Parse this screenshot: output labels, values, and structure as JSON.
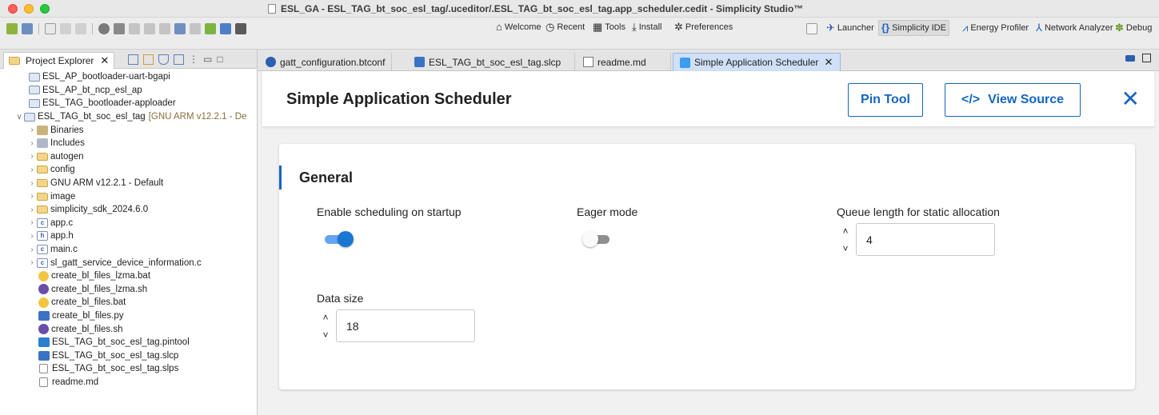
{
  "window": {
    "title": "ESL_GA - ESL_TAG_bt_soc_esl_tag/.uceditor/.ESL_TAG_bt_soc_esl_tag.app_scheduler.cedit - Simplicity Studio™"
  },
  "toolbar": {
    "welcome": "Welcome",
    "recent": "Recent",
    "tools": "Tools",
    "install": "Install",
    "preferences": "Preferences",
    "perspectives": {
      "launcher": "Launcher",
      "ide": "Simplicity IDE",
      "energy": "Energy Profiler",
      "network": "Network Analyzer",
      "debug": "Debug"
    }
  },
  "explorer": {
    "tab_label": "Project Explorer",
    "items": [
      {
        "label": "ESL_AP_bootloader-uart-bgapi",
        "icon": "project-closed-icon"
      },
      {
        "label": "ESL_AP_bt_ncp_esl_ap",
        "icon": "project-closed-icon"
      },
      {
        "label": "ESL_TAG_bootloader-apploader",
        "icon": "project-closed-icon"
      },
      {
        "label": "ESL_TAG_bt_soc_esl_tag",
        "annotation": "[GNU ARM v12.2.1 - De",
        "icon": "project-open-icon"
      },
      {
        "label": "Binaries",
        "icon": "binaries-icon"
      },
      {
        "label": "Includes",
        "icon": "includes-icon"
      },
      {
        "label": "autogen",
        "icon": "folder-icon"
      },
      {
        "label": "config",
        "icon": "folder-icon"
      },
      {
        "label": "GNU ARM v12.2.1 - Default",
        "icon": "folder-icon"
      },
      {
        "label": "image",
        "icon": "folder-icon"
      },
      {
        "label": "simplicity_sdk_2024.6.0",
        "icon": "folder-icon"
      },
      {
        "label": "app.c",
        "icon": "c-file-icon"
      },
      {
        "label": "app.h",
        "icon": "h-file-icon"
      },
      {
        "label": "main.c",
        "icon": "c-file-icon"
      },
      {
        "label": "sl_gatt_service_device_information.c",
        "icon": "c-file-icon"
      },
      {
        "label": "create_bl_files_lzma.bat",
        "icon": "bat-file-icon"
      },
      {
        "label": "create_bl_files_lzma.sh",
        "icon": "sh-file-icon"
      },
      {
        "label": "create_bl_files.bat",
        "icon": "bat-file-icon"
      },
      {
        "label": "create_bl_files.py",
        "icon": "py-file-icon"
      },
      {
        "label": "create_bl_files.sh",
        "icon": "sh-file-icon"
      },
      {
        "label": "ESL_TAG_bt_soc_esl_tag.pintool",
        "icon": "pintool-file-icon"
      },
      {
        "label": "ESL_TAG_bt_soc_esl_tag.slcp",
        "icon": "slcp-file-icon"
      },
      {
        "label": "ESL_TAG_bt_soc_esl_tag.slps",
        "icon": "doc-file-icon"
      },
      {
        "label": "readme.md",
        "icon": "doc-file-icon"
      }
    ]
  },
  "editor_tabs": [
    {
      "label": "gatt_configuration.btconf",
      "icon": "bluetooth-icon"
    },
    {
      "label": "ESL_TAG_bt_soc_esl_tag.slcp",
      "icon": "slcp-file-icon"
    },
    {
      "label": "readme.md",
      "icon": "doc-file-icon"
    },
    {
      "label": "Simple Application Scheduler",
      "icon": "component-icon",
      "active": true
    }
  ],
  "editor": {
    "title": "Simple Application Scheduler",
    "pin_tool": "Pin Tool",
    "view_source": "View Source",
    "view_source_glyph": "</>",
    "section": "General",
    "fields": {
      "scheduling_label": "Enable scheduling on startup",
      "scheduling_on": true,
      "eager_label": "Eager mode",
      "eager_on": false,
      "queue_label": "Queue length for static allocation",
      "queue_value": "4",
      "data_size_label": "Data size",
      "data_size_value": "18"
    }
  },
  "colors": {
    "accent": "#1565c0",
    "toggle_on_track": "#64a4f0",
    "toggle_on_knob": "#1976d2",
    "toggle_off_track": "#8e8e8e",
    "toggle_off_knob": "#fafafa",
    "active_tab": "#cfe0f7"
  }
}
